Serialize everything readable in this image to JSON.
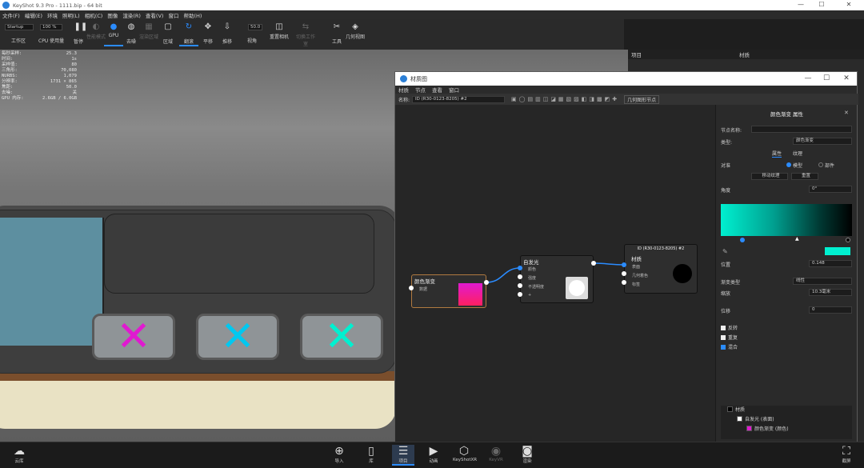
{
  "app": {
    "title": "KeyShot 9.3 Pro  - 1111.bip  - 64 bit"
  },
  "menu": [
    "文件(F)",
    "编辑(E)",
    "环境",
    "照明(L)",
    "相机(C)",
    "图像",
    "渲染(R)",
    "查看(V)",
    "窗口",
    "帮助(H)"
  ],
  "toolbar": {
    "workspace_value": "Startup",
    "workspace_label": "工作区",
    "cpu_value": "100 %",
    "cpu_label": "CPU 使用量",
    "buttons": [
      {
        "label": "暂停",
        "icon": "pause-icon",
        "glyph": "❚❚",
        "active": false,
        "dim": false
      },
      {
        "label": "性能模式",
        "icon": "performance-icon",
        "glyph": "◐",
        "active": false,
        "dim": true
      },
      {
        "label": "GPU",
        "icon": "gpu-icon",
        "glyph": "●",
        "active": true,
        "dim": false
      },
      {
        "label": "去噪",
        "icon": "denoise-icon",
        "glyph": "◍",
        "active": false,
        "dim": false
      },
      {
        "label": "渲染区域",
        "icon": "region-icon",
        "glyph": "▦",
        "active": false,
        "dim": true
      },
      {
        "label": "区域",
        "icon": "area-icon",
        "glyph": "▢",
        "active": false,
        "dim": false
      },
      {
        "label": "翻滚",
        "icon": "tumble-icon",
        "glyph": "↻",
        "active": true,
        "dim": false
      },
      {
        "label": "平移",
        "icon": "pan-icon",
        "glyph": "✥",
        "active": false,
        "dim": false
      },
      {
        "label": "推移",
        "icon": "dolly-icon",
        "glyph": "⇩",
        "active": false,
        "dim": false
      }
    ],
    "fov_value": "50.0",
    "fov_label": "视角",
    "reset_label": "重置相机",
    "switch_label": "切换工作室",
    "tools_label": "工具",
    "geometry_view_label": "几何视图"
  },
  "stats": [
    [
      "每秒采样:",
      "25.3"
    ],
    [
      "时间:",
      "1s"
    ],
    [
      "采样值:",
      "80"
    ],
    [
      "三角形:",
      "70,080"
    ],
    [
      "NURBS:",
      "1,079"
    ],
    [
      "分辨率:",
      "1731 × 865"
    ],
    [
      "焦距:",
      "50.0"
    ],
    [
      "去噪:",
      "关"
    ],
    [
      "GPU 内存:",
      "2.6GB / 6.0GB"
    ]
  ],
  "right_panel": {
    "left_title": "项目",
    "right_title": "材质"
  },
  "material_graph": {
    "window_title": "材质图",
    "menu": [
      "材质",
      "节点",
      "查看",
      "窗口"
    ],
    "name_label": "名称:",
    "name_value": "ID (R30-0123-8205) #2",
    "geometry_node_button": "几何图形节点",
    "nodes": {
      "gradient": {
        "title": "颜色渐变",
        "port": "数据"
      },
      "emissive": {
        "title": "自发光",
        "ports": [
          "颜色",
          "强度",
          "不透明度",
          "+"
        ]
      },
      "material": {
        "title": "ID (R30-0123-8205) #2",
        "subtitle": "材质",
        "ports": [
          "表面",
          "几何着色",
          "标签"
        ]
      }
    },
    "props": {
      "header": "颜色渐变 属性",
      "node_name_label": "节点名称:",
      "type_label": "类型:",
      "type_value": "颜色渐变",
      "tab_props": "属性",
      "tab_texture": "纹理",
      "map_label": "对准",
      "radio_model": "模型",
      "radio_part": "部件",
      "move_texture": "移动纹理",
      "reset": "重置",
      "angle_label": "角度",
      "angle_value": "0°",
      "position_label": "位置",
      "position_value": "0.148",
      "gradient_type_label": "渐变类型",
      "gradient_type_value": "线性",
      "scale_label": "缩放",
      "scale_value": "10.3毫米",
      "offset_label": "位移",
      "offset_value": "0",
      "invert": "反转",
      "repeat": "重复",
      "blend": "混合",
      "tree": [
        {
          "label": "材质",
          "swatch": "#000000"
        },
        {
          "label": "自发光 (表面)",
          "swatch": "#ffffff"
        },
        {
          "label": "颜色渐变 (颜色)",
          "swatch": "#e01ad0"
        }
      ]
    }
  },
  "bottom_bar": {
    "library_label": "云库",
    "buttons": [
      {
        "label": "导入",
        "icon": "import-icon",
        "glyph": "⊕",
        "active": false,
        "dim": false
      },
      {
        "label": "库",
        "icon": "library-icon",
        "glyph": "▯",
        "active": false,
        "dim": false
      },
      {
        "label": "项目",
        "icon": "project-icon",
        "glyph": "☰",
        "active": true,
        "dim": false
      },
      {
        "label": "动画",
        "icon": "animation-icon",
        "glyph": "▶",
        "active": false,
        "dim": false
      },
      {
        "label": "KeyShotXR",
        "icon": "keyshotxr-icon",
        "glyph": "⬡",
        "active": false,
        "dim": false
      },
      {
        "label": "KeyVR",
        "icon": "keyvr-icon",
        "glyph": "◉",
        "active": false,
        "dim": true
      },
      {
        "label": "渲染",
        "icon": "render-icon",
        "glyph": "◙",
        "active": false,
        "dim": false
      }
    ],
    "screenshot_label": "截屏"
  },
  "colors": {
    "accent": "#2b8cff",
    "magenta": "#e01ad0",
    "cyan": "#00f0e0"
  }
}
